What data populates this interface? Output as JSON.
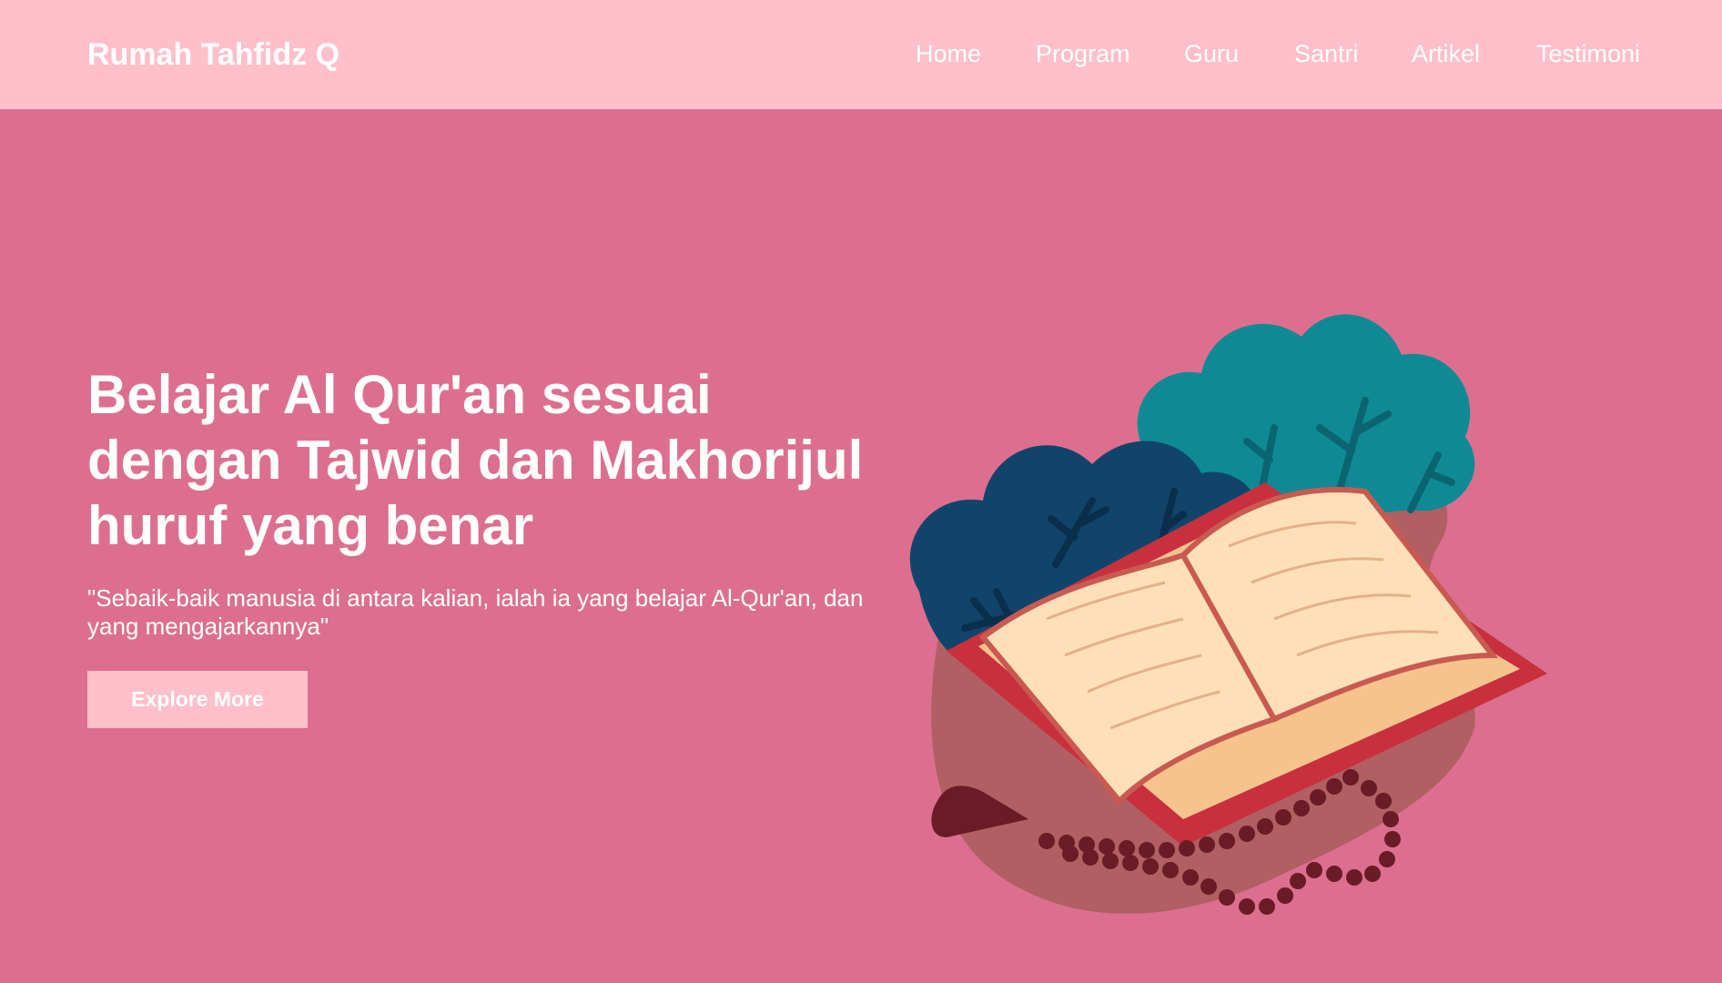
{
  "header": {
    "brand": "Rumah Tahfidz Q",
    "nav": [
      {
        "label": "Home"
      },
      {
        "label": "Program"
      },
      {
        "label": "Guru"
      },
      {
        "label": "Santri"
      },
      {
        "label": "Artikel"
      },
      {
        "label": "Testimoni"
      }
    ]
  },
  "hero": {
    "title": "Belajar Al Qur'an sesuai dengan Tajwid dan Makhorijul huruf yang benar",
    "quote": "\"Sebaik-baik manusia di antara kalian, ialah ia yang belajar Al-Qur'an, dan yang mengajarkannya\"",
    "button_label": "Explore More",
    "illustration": {
      "icon": "open-quran-icon",
      "blob_color": "#b15f62",
      "bush_dark_color": "#11446b",
      "bush_teal_color": "#0f8a95",
      "book_cover_color": "#c8303e",
      "page_color": "#fde0b7",
      "beads_color": "#6b1b26"
    }
  },
  "colors": {
    "header_bg": "#ffbfcb",
    "hero_bg": "#dc6f8f",
    "button_bg": "#ffbfcb",
    "text": "#ffffff"
  }
}
